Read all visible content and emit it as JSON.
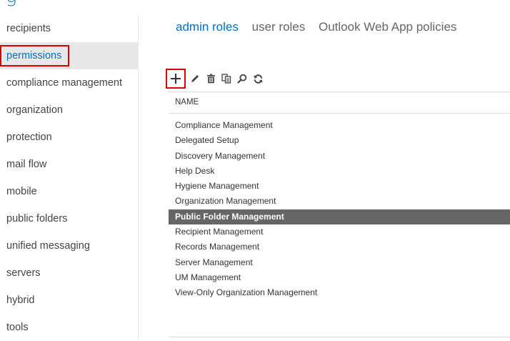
{
  "header": {
    "title_partial": "g"
  },
  "sidebar": {
    "items": [
      {
        "label": "recipients"
      },
      {
        "label": "permissions"
      },
      {
        "label": "compliance management"
      },
      {
        "label": "organization"
      },
      {
        "label": "protection"
      },
      {
        "label": "mail flow"
      },
      {
        "label": "mobile"
      },
      {
        "label": "public folders"
      },
      {
        "label": "unified messaging"
      },
      {
        "label": "servers"
      },
      {
        "label": "hybrid"
      },
      {
        "label": "tools"
      }
    ]
  },
  "tabs": [
    {
      "label": "admin roles"
    },
    {
      "label": "user roles"
    },
    {
      "label": "Outlook Web App policies"
    }
  ],
  "toolbar": {
    "icons": [
      "add-icon",
      "edit-icon",
      "delete-icon",
      "copy-icon",
      "search-icon",
      "refresh-icon"
    ]
  },
  "table": {
    "header": "NAME",
    "rows": [
      "Compliance Management",
      "Delegated Setup",
      "Discovery Management",
      "Help Desk",
      "Hygiene Management",
      "Organization Management",
      "Public Folder Management",
      "Recipient Management",
      "Records Management",
      "Server Management",
      "UM Management",
      "View-Only Organization Management"
    ]
  },
  "colors": {
    "accent": "#0072c6",
    "highlight_box": "#e00000",
    "selected_row": "#666666"
  }
}
